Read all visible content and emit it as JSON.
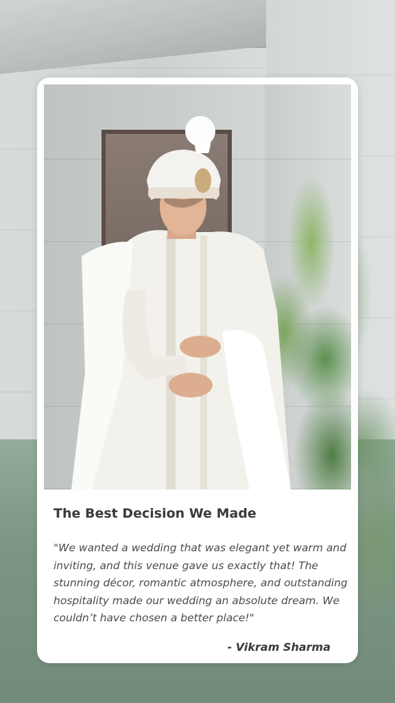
{
  "testimonial": {
    "title": "The Best Decision We Made",
    "quote": "\"We wanted a wedding that was elegant yet warm and inviting, and this venue gave us exactly that! The stunning décor, romantic atmosphere, and outstanding hospitality made our wedding an absolute dream. We couldn’t have chosen a better place!\"",
    "author": "- Vikram Sharma"
  },
  "colors": {
    "card_background": "#ffffff",
    "title_text": "#3a3a3a",
    "body_text": "#4a4a4a",
    "outfit": "#f3f1ec"
  }
}
